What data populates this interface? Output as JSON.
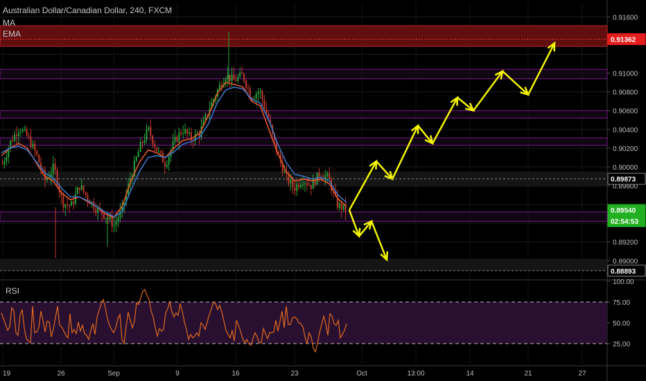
{
  "header": {
    "title": "Australian Dollar/Canadian Dollar, 240, FXCM",
    "studies": [
      "MA",
      "EMA"
    ]
  },
  "rsi_panel": {
    "label": "RSI"
  },
  "colors": {
    "background": "#000000",
    "up_candle": "#26a43a",
    "down_candle": "#c0392b",
    "ma_line": "#e2572b",
    "ema_line": "#3b73c4",
    "zone_red": "#6b0f0f",
    "zone_purple": "#7a1a8a",
    "arrow": "#f5f500",
    "rsi_line": "#e06a1e",
    "rsi_band": "#2a1030",
    "price_badge_red": "#e41d1d",
    "price_badge_green": "#22b022",
    "grid": "#1e1e1e",
    "axis_text": "#bfbfbf"
  },
  "chart_data": [
    {
      "type": "candlestick",
      "title": "Australian Dollar/Canadian Dollar, 240, FXCM",
      "ylim": [
        0.8881,
        0.9175
      ],
      "y_ticks": [
        "0.91600",
        "0.91362",
        "0.91000",
        "0.90800",
        "0.90600",
        "0.90400",
        "0.90200",
        "0.90000",
        "0.89873",
        "0.89800",
        "0.89540",
        "0.89200",
        "0.89000",
        "0.88893"
      ],
      "x_labels": [
        "19",
        "26",
        "Sep",
        "9",
        "16",
        "23",
        "Oct",
        "13:00",
        "14",
        "21",
        "27"
      ],
      "price_badges": [
        {
          "label": "0.91362",
          "value": 0.91362,
          "color": "red"
        },
        {
          "label": "0.89873",
          "value": 0.89873,
          "color": "dark"
        },
        {
          "label": "0.89540",
          "value": 0.8954,
          "color": "green"
        },
        {
          "label": "02:54:53",
          "value": 0.8946,
          "color": "green"
        },
        {
          "label": "0.88893",
          "value": 0.88893,
          "color": "dark"
        }
      ],
      "zones": [
        {
          "kind": "red",
          "from": 0.91285,
          "to": 0.91505
        },
        {
          "kind": "purple",
          "from": 0.9094,
          "to": 0.9104
        },
        {
          "kind": "purple",
          "from": 0.9052,
          "to": 0.906
        },
        {
          "kind": "purple",
          "from": 0.9023,
          "to": 0.9031
        },
        {
          "kind": "purple",
          "from": 0.8942,
          "to": 0.8952
        }
      ],
      "candle_path": [
        0.9003,
        0.9028,
        0.9042,
        0.9031,
        0.9012,
        0.8985,
        0.9,
        0.8962,
        0.8958,
        0.898,
        0.8966,
        0.8955,
        0.8948,
        0.8938,
        0.8955,
        0.899,
        0.902,
        0.904,
        0.9018,
        0.9003,
        0.9026,
        0.904,
        0.903,
        0.9036,
        0.906,
        0.908,
        0.9098,
        0.9092,
        0.9098,
        0.9075,
        0.9081,
        0.905,
        0.9016,
        0.899,
        0.8977,
        0.8987,
        0.898,
        0.8993,
        0.8988,
        0.896,
        0.8954
      ],
      "ma_path": [
        0.9012,
        0.902,
        0.9025,
        0.902,
        0.9005,
        0.899,
        0.8985,
        0.8972,
        0.8965,
        0.8968,
        0.8963,
        0.8958,
        0.895,
        0.8946,
        0.8958,
        0.8985,
        0.9005,
        0.9018,
        0.9015,
        0.901,
        0.902,
        0.9028,
        0.903,
        0.9036,
        0.9055,
        0.9078,
        0.909,
        0.9088,
        0.9085,
        0.907,
        0.9065,
        0.904,
        0.9015,
        0.8995,
        0.8985,
        0.8987,
        0.8985,
        0.8987,
        0.8982,
        0.8966,
        0.8958
      ],
      "ema_path": [
        0.9015,
        0.902,
        0.9022,
        0.9018,
        0.9006,
        0.8994,
        0.8988,
        0.8977,
        0.8968,
        0.8968,
        0.8964,
        0.8958,
        0.8952,
        0.8947,
        0.8952,
        0.8975,
        0.8995,
        0.901,
        0.9012,
        0.901,
        0.9016,
        0.9024,
        0.9027,
        0.9032,
        0.9046,
        0.9068,
        0.9082,
        0.9085,
        0.9083,
        0.9072,
        0.9068,
        0.905,
        0.9025,
        0.9005,
        0.8992,
        0.899,
        0.8987,
        0.8989,
        0.8985,
        0.897,
        0.8962
      ],
      "projection_up": [
        {
          "x": "13:00",
          "y": 0.8954
        },
        {
          "x": "",
          "y": 0.9006
        },
        {
          "x": "",
          "y": 0.8987
        },
        {
          "x": "",
          "y": 0.9044
        },
        {
          "x": "",
          "y": 0.9025
        },
        {
          "x": "",
          "y": 0.9074
        },
        {
          "x": "",
          "y": 0.906
        },
        {
          "x": "",
          "y": 0.9102
        },
        {
          "x": "",
          "y": 0.9077
        },
        {
          "x": "27",
          "y": 0.9132
        }
      ],
      "projection_down": [
        {
          "x": "",
          "y": 0.8954
        },
        {
          "x": "",
          "y": 0.8926
        },
        {
          "x": "",
          "y": 0.8942
        },
        {
          "x": "",
          "y": 0.8901
        }
      ]
    },
    {
      "type": "line",
      "title": "RSI",
      "ylim": [
        0,
        100
      ],
      "y_ticks": [
        "100.00",
        "75.00",
        "50.00",
        "25.00"
      ],
      "levels": [
        75,
        25
      ],
      "values": [
        62,
        55,
        48,
        41,
        45,
        68,
        64,
        38,
        35,
        59,
        66,
        44,
        31,
        28,
        26,
        70,
        38,
        39,
        44,
        64,
        53,
        39,
        52,
        51,
        33,
        43,
        56,
        70,
        47,
        45,
        40,
        35,
        32,
        61,
        38,
        42,
        37,
        51,
        40,
        47,
        37,
        35,
        30,
        41,
        49,
        36,
        57,
        65,
        73,
        78,
        68,
        55,
        47,
        42,
        38,
        44,
        55,
        60,
        30,
        25,
        46,
        63,
        53,
        44,
        52,
        74,
        72,
        80,
        88,
        90,
        83,
        78,
        64,
        57,
        44,
        34,
        43,
        40,
        42,
        62,
        67,
        75,
        63,
        57,
        62,
        59,
        73,
        64,
        51,
        42,
        30,
        36,
        32,
        34,
        38,
        34,
        50,
        47,
        42,
        51,
        60,
        67,
        75,
        73,
        66,
        71,
        63,
        52,
        41,
        36,
        32,
        41,
        28,
        53,
        47,
        40,
        31,
        26,
        30,
        25,
        23,
        31,
        38,
        33,
        26,
        26,
        43,
        37,
        31,
        38,
        38,
        39,
        53,
        40,
        52,
        64,
        44,
        70,
        48,
        48,
        56,
        57,
        55,
        50,
        49,
        45,
        33,
        25,
        38,
        33,
        19,
        15,
        25,
        38,
        48,
        58,
        49,
        35,
        61,
        58,
        49,
        47,
        53,
        32,
        36,
        41,
        49
      ]
    }
  ]
}
